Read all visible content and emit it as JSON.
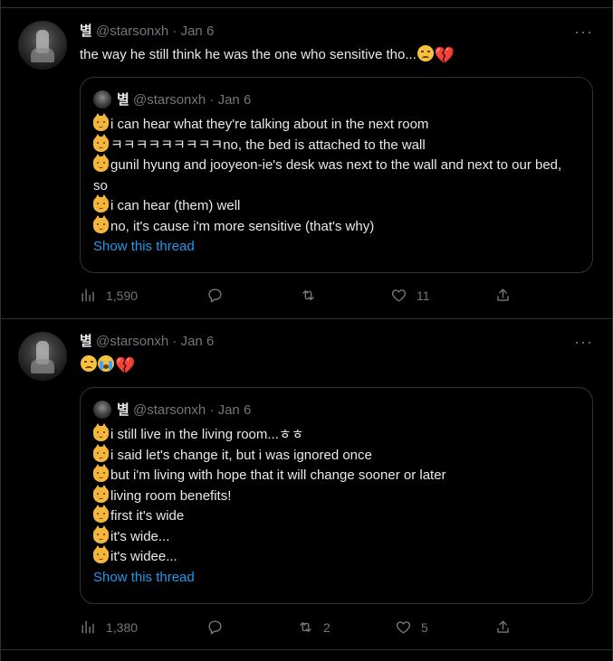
{
  "tweets": [
    {
      "name": "별",
      "handle": "@starsonxh",
      "date": "Jan 6",
      "text": "the way he still think he was the one who sensitive tho...",
      "emojis": [
        "sad-face",
        "broken-heart"
      ],
      "quote": {
        "name": "별",
        "handle": "@starsonxh",
        "date": "Jan 6",
        "lines": [
          "i can hear what they're talking about in the next room",
          "ㅋㅋㅋㅋㅋㅋㅋㅋㅋno, the bed is attached to the wall",
          "gunil hyung and jooyeon-ie's desk was next to the wall and next to our bed, so",
          "i can hear (them) well",
          "no, it's cause i'm more sensitive (that's why)"
        ],
        "show_thread": "Show this thread"
      },
      "actions": {
        "views": "1,590",
        "replies": "",
        "retweets": "",
        "likes": "11"
      }
    },
    {
      "name": "별",
      "handle": "@starsonxh",
      "date": "Jan 6",
      "text": "",
      "emojis": [
        "sad-face",
        "crying-face",
        "broken-heart"
      ],
      "quote": {
        "name": "별",
        "handle": "@starsonxh",
        "date": "Jan 6",
        "lines": [
          "i still live in the living room...ㅎㅎ",
          "i said let's change it, but i was ignored once",
          "but i'm living with hope that it will change sooner or later",
          "living room benefits!",
          "first it's wide",
          "it's wide...",
          "it's widee..."
        ],
        "show_thread": "Show this thread"
      },
      "actions": {
        "views": "1,380",
        "replies": "",
        "retweets": "2",
        "likes": "5"
      }
    }
  ],
  "colors": {
    "background": "#000000",
    "text": "#e7e9ea",
    "muted": "#71767b",
    "link": "#1d9bf0",
    "border": "#2f3336",
    "broken_heart": "#e0245e"
  }
}
